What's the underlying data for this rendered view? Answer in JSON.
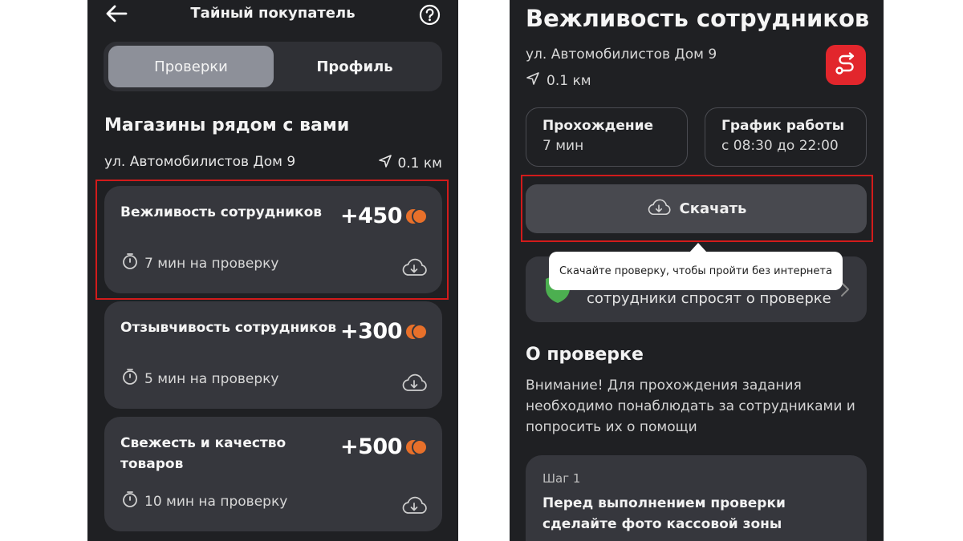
{
  "left": {
    "header": {
      "title": "Тайный покупатель"
    },
    "tabs": [
      {
        "label": "Проверки",
        "active": true
      },
      {
        "label": "Профиль",
        "active": false
      }
    ],
    "section_title": "Магазины рядом с вами",
    "address": "ул. Автомобилистов Дом 9",
    "distance": "0.1 км",
    "tasks": [
      {
        "title": "Вежливость сотрудников",
        "reward": "+450",
        "duration": "7 мин на проверку"
      },
      {
        "title": "Отзывчивость сотрудников",
        "reward": "+300",
        "duration": "5 мин на проверку"
      },
      {
        "title": "Свежесть и качество товаров",
        "reward": "+500",
        "duration": "10 мин на проверку"
      }
    ]
  },
  "right": {
    "title": "Вежливость сотрудников",
    "address": "ул. Автомобилистов Дом 9",
    "distance": "0.1 км",
    "info": [
      {
        "label": "Прохождение",
        "value": "7 мин"
      },
      {
        "label": "График работы",
        "value": "с 08:30 до 22:00"
      }
    ],
    "download_label": "Скачать",
    "tooltip": "Скачайте проверку, чтобы пройти без интернета",
    "partial_card_text": "сотрудники спросят о проверке",
    "about_title": "О проверке",
    "about_text": "Внимание! Для прохождения задания необходимо понаблюдать за сотрудниками и попросить их о помощи",
    "step": {
      "label": "Шаг 1",
      "text": "Перед выполнением проверки сделайте фото кассовой зоны"
    }
  },
  "colors": {
    "background": "#1f2023",
    "card": "#36373d",
    "accent_red": "#e2262c",
    "highlight_border": "#d21b1b",
    "coin_orange": "#e8702a"
  },
  "icons": [
    "back-arrow-icon",
    "help-icon",
    "navigation-arrow-icon",
    "coin-icon",
    "timer-icon",
    "cloud-download-icon",
    "route-icon",
    "shield-icon",
    "chevron-right-icon"
  ]
}
